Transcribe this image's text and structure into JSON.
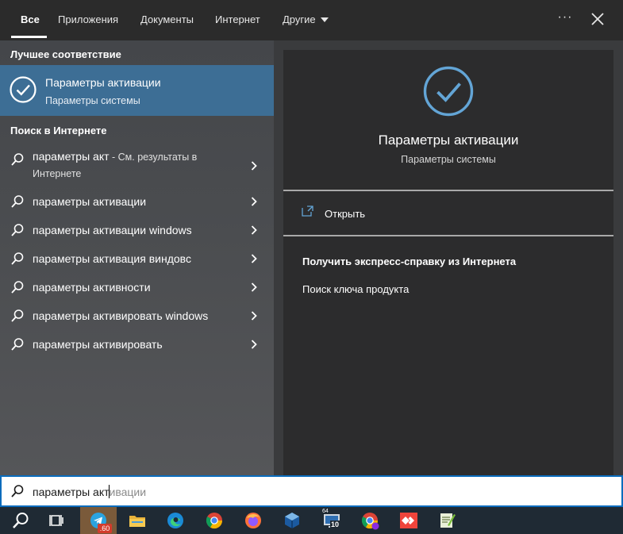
{
  "tabs": [
    {
      "label": "Все",
      "active": true
    },
    {
      "label": "Приложения"
    },
    {
      "label": "Документы"
    },
    {
      "label": "Интернет"
    },
    {
      "label": "Другие"
    }
  ],
  "header": {
    "more_icon": "more-dots-icon",
    "close_icon": "close-icon"
  },
  "left": {
    "best_match_title": "Лучшее соответствие",
    "best_match": {
      "title": "Параметры активации",
      "subtitle": "Параметры системы",
      "icon": "check-circle-icon"
    },
    "web_title": "Поиск в Интернете",
    "suggestions": [
      {
        "text": "параметры акт",
        "hint": " - См. результаты в Интернете"
      },
      {
        "text": "параметры активации"
      },
      {
        "text": "параметры активации windows"
      },
      {
        "text": "параметры активация виндовс"
      },
      {
        "text": "параметры активности"
      },
      {
        "text": "параметры активировать windows"
      },
      {
        "text": "параметры активировать"
      }
    ]
  },
  "preview": {
    "title": "Параметры активации",
    "subtitle": "Параметры системы",
    "open_label": "Открыть",
    "help_title": "Получить экспресс-справку из Интернета",
    "help_link": "Поиск ключа продукта"
  },
  "search": {
    "typed_before_cursor": "параметры акт",
    "completion": "ивации"
  },
  "taskbar": {
    "telegram_badge": "60",
    "win_version_badge": "10",
    "win_version_bits": "64"
  },
  "colors": {
    "accent": "#3d6e95",
    "icon_blue": "#63a5d6",
    "search_border": "#0a6cbd"
  }
}
